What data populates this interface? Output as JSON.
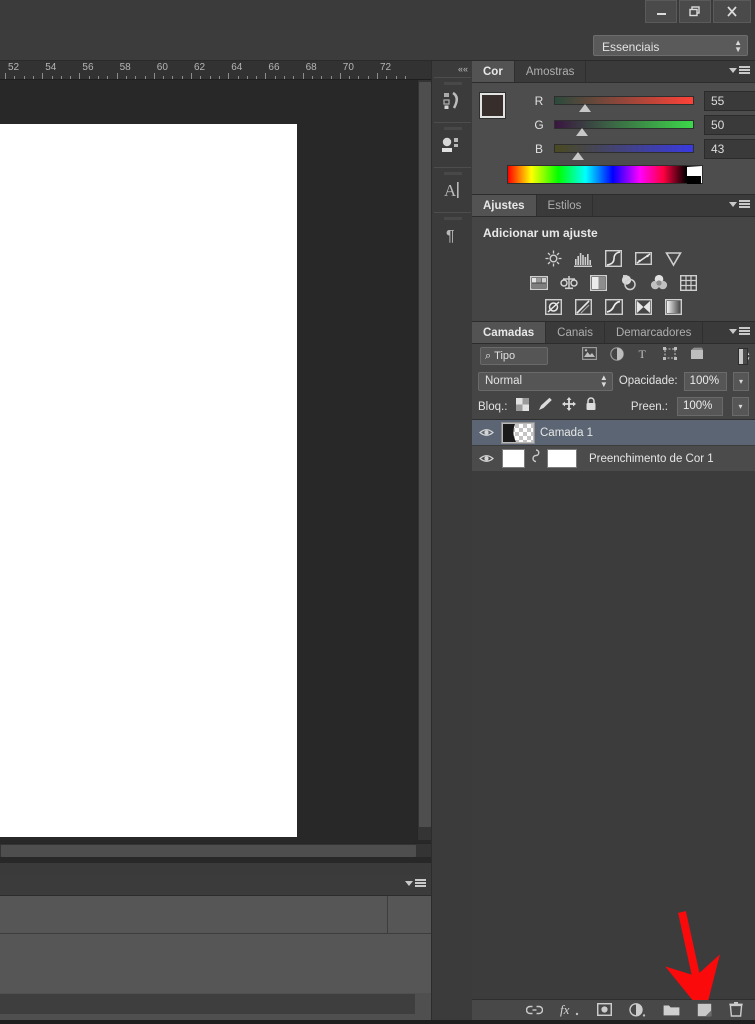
{
  "window": {
    "minimize_label": "—",
    "restore_label": "❐",
    "close_label": "✕"
  },
  "options_bar": {
    "workspace_label": "Essenciais"
  },
  "document": {
    "ruler_unit_marks": [
      "52",
      "54",
      "56",
      "58",
      "60",
      "62",
      "64",
      "66",
      "68",
      "70",
      "72"
    ],
    "canvas_color": "#ffffff"
  },
  "icon_dock": {
    "collapse_label": "««",
    "items": [
      {
        "name": "histogram-styles-icon",
        "glyph": "▤"
      },
      {
        "name": "swatches-properties-icon",
        "glyph": "▥"
      },
      {
        "name": "character-icon",
        "glyph": "A"
      },
      {
        "name": "paragraph-icon",
        "glyph": "¶"
      }
    ]
  },
  "color_panel": {
    "tabs": [
      {
        "label": "Cor",
        "active": true
      },
      {
        "label": "Amostras",
        "active": false
      }
    ],
    "foreground_color": "#372d2b",
    "background_color": "#c07ab5",
    "channels": [
      {
        "label": "R",
        "value": "55",
        "from": "#2a4a3c",
        "to": "#ff4238",
        "knob_pct": 22
      },
      {
        "label": "G",
        "value": "50",
        "from": "#3a1540",
        "to": "#3cd94a",
        "knob_pct": 20
      },
      {
        "label": "B",
        "value": "43",
        "from": "#4a4a20",
        "to": "#3a3ae0",
        "knob_pct": 17
      }
    ]
  },
  "adjustments_panel": {
    "tabs": [
      {
        "label": "Ajustes",
        "active": true
      },
      {
        "label": "Estilos",
        "active": false
      }
    ],
    "heading": "Adicionar um ajuste",
    "rows": [
      [
        {
          "name": "brightness-contrast-icon",
          "glyph": "☀"
        },
        {
          "name": "levels-icon",
          "glyph": "▥"
        },
        {
          "name": "curves-icon",
          "glyph": "◪"
        },
        {
          "name": "exposure-icon",
          "glyph": "◩"
        },
        {
          "name": "vibrance-icon",
          "glyph": "▽"
        }
      ],
      [
        {
          "name": "hue-saturation-icon",
          "glyph": "▦"
        },
        {
          "name": "color-balance-icon",
          "glyph": "⚖"
        },
        {
          "name": "black-white-icon",
          "glyph": "◧"
        },
        {
          "name": "photo-filter-icon",
          "glyph": "◉"
        },
        {
          "name": "channel-mixer-icon",
          "glyph": "❀"
        },
        {
          "name": "color-lookup-icon",
          "glyph": "▩"
        }
      ],
      [
        {
          "name": "invert-icon",
          "glyph": "◐"
        },
        {
          "name": "posterize-icon",
          "glyph": "◨"
        },
        {
          "name": "threshold-icon",
          "glyph": "◣"
        },
        {
          "name": "selective-color-icon",
          "glyph": "◀"
        },
        {
          "name": "gradient-map-icon",
          "glyph": "▤"
        }
      ]
    ]
  },
  "layers_panel": {
    "tabs": [
      {
        "label": "Camadas",
        "active": true
      },
      {
        "label": "Canais",
        "active": false
      },
      {
        "label": "Demarcadores",
        "active": false
      }
    ],
    "filter": {
      "select_label": "Tipo",
      "search_icon": "⌕",
      "icons": [
        {
          "name": "filter-pixel-layers-icon",
          "glyph": "🖼"
        },
        {
          "name": "filter-adjustment-layers-icon",
          "glyph": "◑"
        },
        {
          "name": "filter-type-layers-icon",
          "glyph": "T"
        },
        {
          "name": "filter-shape-layers-icon",
          "glyph": "⬚"
        },
        {
          "name": "filter-smart-object-icon",
          "glyph": "⬔"
        }
      ]
    },
    "blend": {
      "mode": "Normal",
      "opacity_label": "Opacidade:",
      "opacity_value": "100%"
    },
    "lock": {
      "label": "Bloq.:",
      "icons": [
        {
          "name": "lock-transparent-pixels-icon",
          "glyph": "▨"
        },
        {
          "name": "lock-image-pixels-icon",
          "glyph": "✎"
        },
        {
          "name": "lock-position-icon",
          "glyph": "✛"
        },
        {
          "name": "lock-all-icon",
          "glyph": "🔒"
        }
      ],
      "fill_label": "Preen.:",
      "fill_value": "100%"
    },
    "layers": [
      {
        "name": "Camada 1",
        "selected": true,
        "visible": true,
        "thumb_type": "checker",
        "has_link": false
      },
      {
        "name": "Preenchimento de Cor 1",
        "selected": false,
        "visible": true,
        "thumb_type": "fill-with-mask",
        "has_link": true
      }
    ],
    "footer_buttons": [
      {
        "name": "link-layers-button",
        "glyph": "⚭"
      },
      {
        "name": "layer-style-fx-button",
        "glyph": "fx"
      },
      {
        "name": "add-layer-mask-button",
        "glyph": "◙"
      },
      {
        "name": "new-fill-adjustment-layer-button",
        "glyph": "◐"
      },
      {
        "name": "new-group-button",
        "glyph": "📁"
      },
      {
        "name": "new-layer-button",
        "glyph": "❏"
      },
      {
        "name": "delete-layer-button",
        "glyph": "🗑"
      }
    ]
  },
  "annotation": {
    "arrow_color": "#fa0a0a",
    "points_to": "new-layer-button"
  }
}
